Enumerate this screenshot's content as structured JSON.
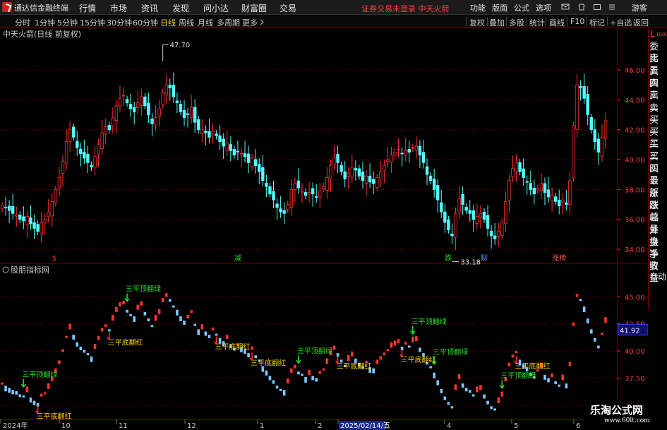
{
  "app": {
    "title": "通达信金融终端"
  },
  "menu": [
    "行情",
    "市场",
    "资讯",
    "发现",
    "问小达",
    "财富圈",
    "交易"
  ],
  "notice": "证券交易未登录  中天火箭",
  "right_menu": [
    "功能",
    "版面",
    "公式",
    "选项",
    "游客"
  ],
  "periods": [
    {
      "label": "分时",
      "active": false
    },
    {
      "label": "1分钟",
      "active": false
    },
    {
      "label": "5分钟",
      "active": false
    },
    {
      "label": "15分钟",
      "active": false
    },
    {
      "label": "30分钟",
      "active": false
    },
    {
      "label": "60分钟",
      "active": false
    },
    {
      "label": "日线",
      "active": true
    },
    {
      "label": "周线",
      "active": false
    },
    {
      "label": "月线",
      "active": false
    },
    {
      "label": "多周期",
      "active": false
    },
    {
      "label": "更多",
      "active": false
    }
  ],
  "tools": [
    "复权",
    "叠加",
    "多股",
    "统计",
    "画线",
    "F10",
    "标记",
    "+自选",
    "返回"
  ],
  "quote_panel": {
    "header": "L",
    "header_small": "1000",
    "rows": [
      "委比",
      "卖五",
      "卖四",
      "卖三",
      "卖二",
      "卖一",
      "买一",
      "买二",
      "买三",
      "买四",
      "买五",
      "最新",
      "涨跌",
      "涨幅",
      "总量",
      "外盘",
      "换手",
      "净资",
      "收益"
    ],
    "auto_label": "自动"
  },
  "watermark": {
    "name": "乐淘公式网",
    "url": "www.60lt.com"
  },
  "colors": {
    "up": "#ff3232",
    "down": "#54ffff",
    "bg": "#000000",
    "grid": "#7a0000",
    "price_axis": "#ff3c3c",
    "signal_up": "#ffd200",
    "signal_down": "#28e028"
  },
  "chart_data": [
    {
      "type": "candlestick",
      "title": "中天火箭(日线 前复权)",
      "ylim": [
        33.2,
        48.6
      ],
      "yticks": [
        34.0,
        36.0,
        38.0,
        40.0,
        42.0,
        44.0,
        46.0
      ],
      "annotations": [
        {
          "text": "47.70",
          "kind": "high"
        },
        {
          "text": "33.18",
          "kind": "low"
        }
      ],
      "event_markers": [
        {
          "text": "$",
          "color": "#ff3232"
        },
        {
          "text": "减",
          "color": "#28e028"
        },
        {
          "text": "跌",
          "color": "#28e028"
        },
        {
          "text": "财",
          "color": "#54a0ff"
        },
        {
          "text": "涨榜",
          "color": "#ff5050"
        }
      ],
      "close": [
        36.9,
        36.8,
        36.6,
        36.4,
        36.3,
        36.0,
        35.9,
        36.2,
        35.7,
        35.4,
        35.2,
        35.8,
        36.0,
        36.5,
        37.2,
        38.0,
        38.8,
        39.9,
        41.2,
        42.0,
        41.5,
        40.8,
        40.4,
        40.1,
        39.8,
        39.5,
        40.2,
        41.0,
        41.8,
        42.2,
        42.0,
        42.8,
        43.6,
        44.1,
        44.3,
        43.8,
        43.4,
        43.2,
        43.8,
        44.2,
        43.6,
        43.0,
        42.4,
        42.8,
        43.4,
        44.5,
        45.0,
        44.8,
        44.2,
        43.8,
        43.2,
        42.8,
        43.0,
        43.5,
        42.5,
        42.0,
        42.0,
        41.8,
        41.5,
        41.9,
        41.6,
        41.2,
        40.9,
        41.1,
        40.6,
        40.3,
        40.5,
        40.4,
        40.2,
        39.8,
        40.1,
        39.6,
        39.2,
        38.6,
        38.2,
        37.7,
        37.3,
        36.8,
        36.5,
        36.4,
        37.0,
        38.0,
        38.4,
        38.1,
        37.9,
        37.6,
        37.8,
        37.7,
        37.5,
        37.9,
        38.2,
        38.8,
        39.6,
        40.1,
        39.8,
        39.2,
        38.7,
        39.1,
        39.5,
        39.3,
        38.9,
        38.6,
        38.9,
        38.5,
        38.4,
        38.8,
        39.2,
        39.6,
        40.0,
        40.3,
        40.5,
        40.7,
        40.4,
        40.6,
        40.5,
        40.8,
        40.9,
        40.3,
        39.8,
        39.0,
        38.6,
        38.0,
        37.3,
        36.5,
        35.8,
        35.3,
        34.9,
        36.4,
        37.4,
        37.0,
        36.6,
        36.4,
        36.0,
        36.2,
        36.4,
        36.0,
        35.4,
        34.9,
        34.7,
        35.2,
        35.8,
        37.2,
        38.6,
        39.4,
        39.8,
        39.2,
        38.8,
        38.5,
        38.0,
        37.7,
        38.1,
        38.4,
        37.8,
        37.5,
        37.6,
        37.2,
        36.9,
        37.3,
        37.0,
        38.6,
        42.3,
        45.0,
        44.8,
        44.1,
        43.0,
        42.0,
        41.2,
        40.5,
        41.5,
        42.6
      ]
    },
    {
      "type": "bar",
      "title": "股朋指标网",
      "ylim": [
        34.6,
        47.3
      ],
      "yticks": [
        35.0,
        37.5,
        40.0,
        42.5,
        45.0
      ],
      "last_value": "41.92",
      "signals": [
        {
          "text": "三平顶翻绿",
          "kind": "top"
        },
        {
          "text": "三平底翻红",
          "kind": "bottom"
        },
        {
          "text": "三平顶翻绿",
          "kind": "top"
        },
        {
          "text": "三平底翻红",
          "kind": "bottom"
        },
        {
          "text": "三平底翻红",
          "kind": "bottom"
        },
        {
          "text": "三平底翻红",
          "kind": "bottom"
        },
        {
          "text": "三平顶翻绿",
          "kind": "top"
        },
        {
          "text": "三平底翻红",
          "kind": "bottom"
        },
        {
          "text": "三平顶翻绿",
          "kind": "top"
        },
        {
          "text": "三平顶翻绿",
          "kind": "top"
        },
        {
          "text": "三平底翻红",
          "kind": "bottom"
        },
        {
          "text": "三平顶翻绿",
          "kind": "top"
        },
        {
          "text": "三平底翻红",
          "kind": "bottom"
        }
      ]
    }
  ],
  "x_axis": {
    "labels": [
      "2024年",
      "10",
      "11",
      "12",
      "1",
      "2",
      "2025/02/14/五",
      "4",
      "5",
      "6"
    ]
  }
}
